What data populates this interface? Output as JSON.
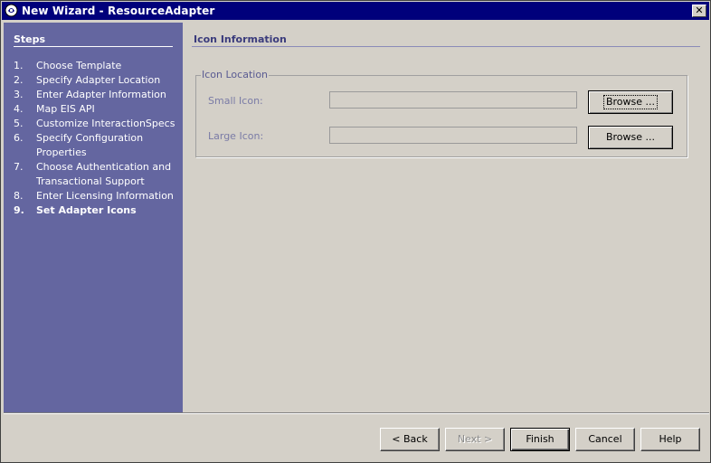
{
  "window": {
    "title": "New Wizard - ResourceAdapter",
    "close_glyph": "✕"
  },
  "sidebar": {
    "heading": "Steps",
    "steps": [
      {
        "num": "1.",
        "label": "Choose Template",
        "current": false
      },
      {
        "num": "2.",
        "label": "Specify Adapter Location",
        "current": false
      },
      {
        "num": "3.",
        "label": "Enter Adapter Information",
        "current": false
      },
      {
        "num": "4.",
        "label": "Map EIS API",
        "current": false
      },
      {
        "num": "5.",
        "label": "Customize InteractionSpecs",
        "current": false
      },
      {
        "num": "6.",
        "label": "Specify Configuration Properties",
        "current": false
      },
      {
        "num": "7.",
        "label": "Choose Authentication and Transactional Support",
        "current": false
      },
      {
        "num": "8.",
        "label": "Enter Licensing Information",
        "current": false
      },
      {
        "num": "9.",
        "label": "Set Adapter Icons",
        "current": true
      }
    ]
  },
  "main": {
    "section_title": "Icon Information",
    "icon_location": {
      "legend": "Icon Location",
      "small_icon_label": "Small Icon:",
      "small_icon_value": "",
      "large_icon_label": "Large Icon:",
      "large_icon_value": "",
      "browse_label": "Browse ..."
    }
  },
  "footer": {
    "back_label": "< Back",
    "next_label": "Next >",
    "finish_label": "Finish",
    "cancel_label": "Cancel",
    "help_label": "Help"
  },
  "colors": {
    "titlebar": "#00007b",
    "sidebar": "#6466a0",
    "section_title": "#3a3b7c"
  }
}
